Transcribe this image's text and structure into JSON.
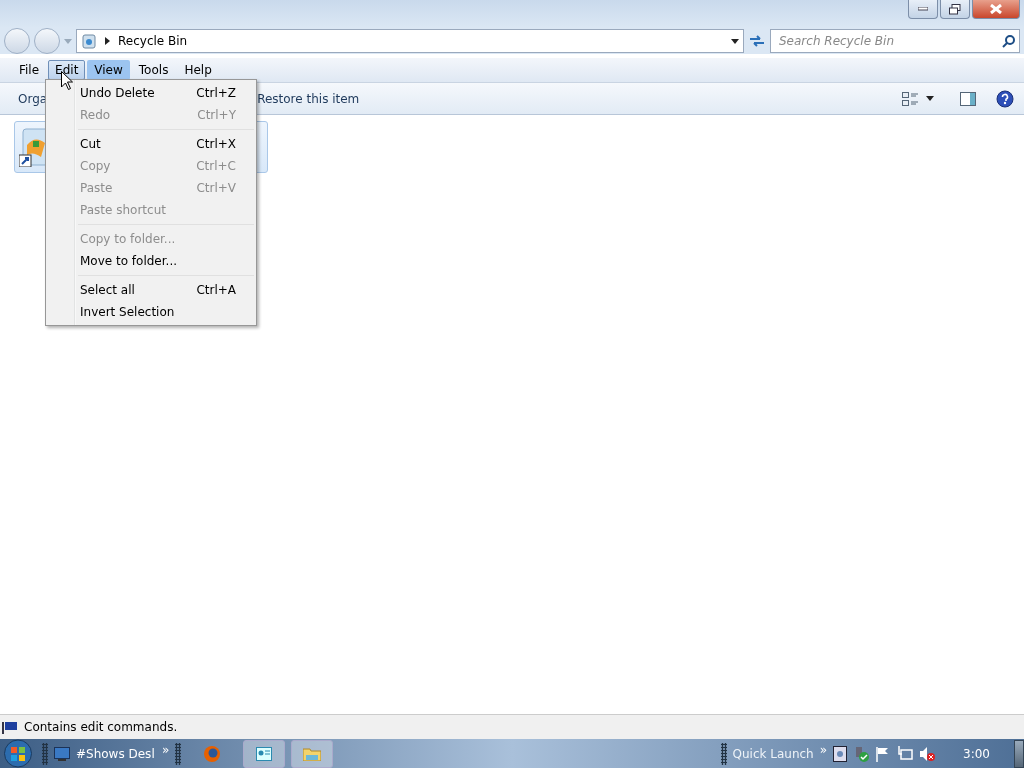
{
  "address_bar": {
    "path": "Recycle Bin"
  },
  "search": {
    "placeholder": "Search Recycle Bin"
  },
  "menu_bar": [
    {
      "label": "File",
      "selected": false,
      "highlighted": false
    },
    {
      "label": "Edit",
      "selected": true,
      "highlighted": false
    },
    {
      "label": "View",
      "selected": false,
      "highlighted": true
    },
    {
      "label": "Tools",
      "selected": false,
      "highlighted": false
    },
    {
      "label": "Help",
      "selected": false,
      "highlighted": false
    }
  ],
  "toolbar": [
    "Orga",
    "Restore this item"
  ],
  "edit_menu": [
    [
      {
        "label": "Undo Delete",
        "shortcut": "Ctrl+Z",
        "disabled": false
      },
      {
        "label": "Redo",
        "shortcut": "Ctrl+Y",
        "disabled": true
      }
    ],
    [
      {
        "label": "Cut",
        "shortcut": "Ctrl+X",
        "disabled": false
      },
      {
        "label": "Copy",
        "shortcut": "Ctrl+C",
        "disabled": true
      },
      {
        "label": "Paste",
        "shortcut": "Ctrl+V",
        "disabled": true
      },
      {
        "label": "Paste shortcut",
        "disabled": true
      }
    ],
    [
      {
        "label": "Copy to folder...",
        "disabled": true
      },
      {
        "label": "Move to folder...",
        "disabled": false
      }
    ],
    [
      {
        "label": "Select all",
        "shortcut": "Ctrl+A",
        "disabled": false
      },
      {
        "label": "Invert Selection",
        "disabled": false
      }
    ]
  ],
  "status_bar": "Contains edit commands.",
  "taskbar": {
    "task": "#Shows Desl",
    "chevron_left": "»",
    "quick_launch": "Quick Launch",
    "chevron_right": "»",
    "clock": "3:00"
  }
}
